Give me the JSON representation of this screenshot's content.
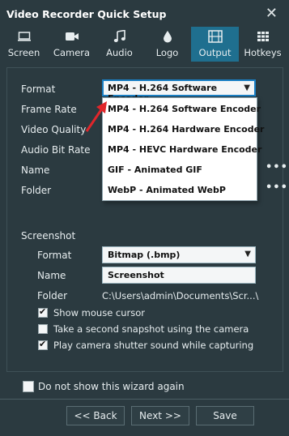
{
  "window": {
    "title": "Video Recorder Quick Setup",
    "close_icon": "close-icon"
  },
  "tabs": [
    {
      "label": "Screen",
      "icon": "monitor-icon"
    },
    {
      "label": "Camera",
      "icon": "video-camera-icon"
    },
    {
      "label": "Audio",
      "icon": "music-icon"
    },
    {
      "label": "Logo",
      "icon": "droplet-icon"
    },
    {
      "label": "Output",
      "icon": "film-icon",
      "active": true
    },
    {
      "label": "Hotkeys",
      "icon": "keyboard-icon"
    }
  ],
  "video": {
    "format_label": "Format",
    "format_value": "MP4 - H.264 Software Encoder",
    "frame_rate_label": "Frame Rate",
    "video_quality_label": "Video Quality",
    "audio_bitrate_label": "Audio Bit Rate",
    "name_label": "Name",
    "folder_label": "Folder",
    "name_more": "•••",
    "folder_more": "•••"
  },
  "format_dropdown": {
    "options": [
      "MP4 - H.264 Software Encoder",
      "MP4 - H.264 Hardware Encoder",
      "MP4 - HEVC Hardware Encoder",
      "GIF - Animated GIF",
      "WebP - Animated WebP"
    ]
  },
  "screenshot": {
    "section_label": "Screenshot",
    "format_label": "Format",
    "format_value": "Bitmap (.bmp)",
    "name_label": "Name",
    "name_value": "Screenshot",
    "folder_label": "Folder",
    "folder_value": "C:\\Users\\admin\\Documents\\Scr...\\",
    "show_cursor_label": "Show mouse cursor",
    "show_cursor_checked": true,
    "second_snapshot_label": "Take a second snapshot using the camera",
    "second_snapshot_checked": false,
    "shutter_sound_label": "Play camera shutter sound while capturing",
    "shutter_sound_checked": true
  },
  "footer": {
    "dont_show_label": "Do not show this wizard again",
    "dont_show_checked": false,
    "back_label": "<<  Back",
    "next_label": "Next  >>",
    "save_label": "Save"
  },
  "colors": {
    "background": "#2b3a40",
    "active_tab": "#1f6f8f",
    "annotation_arrow": "#e0262b"
  }
}
